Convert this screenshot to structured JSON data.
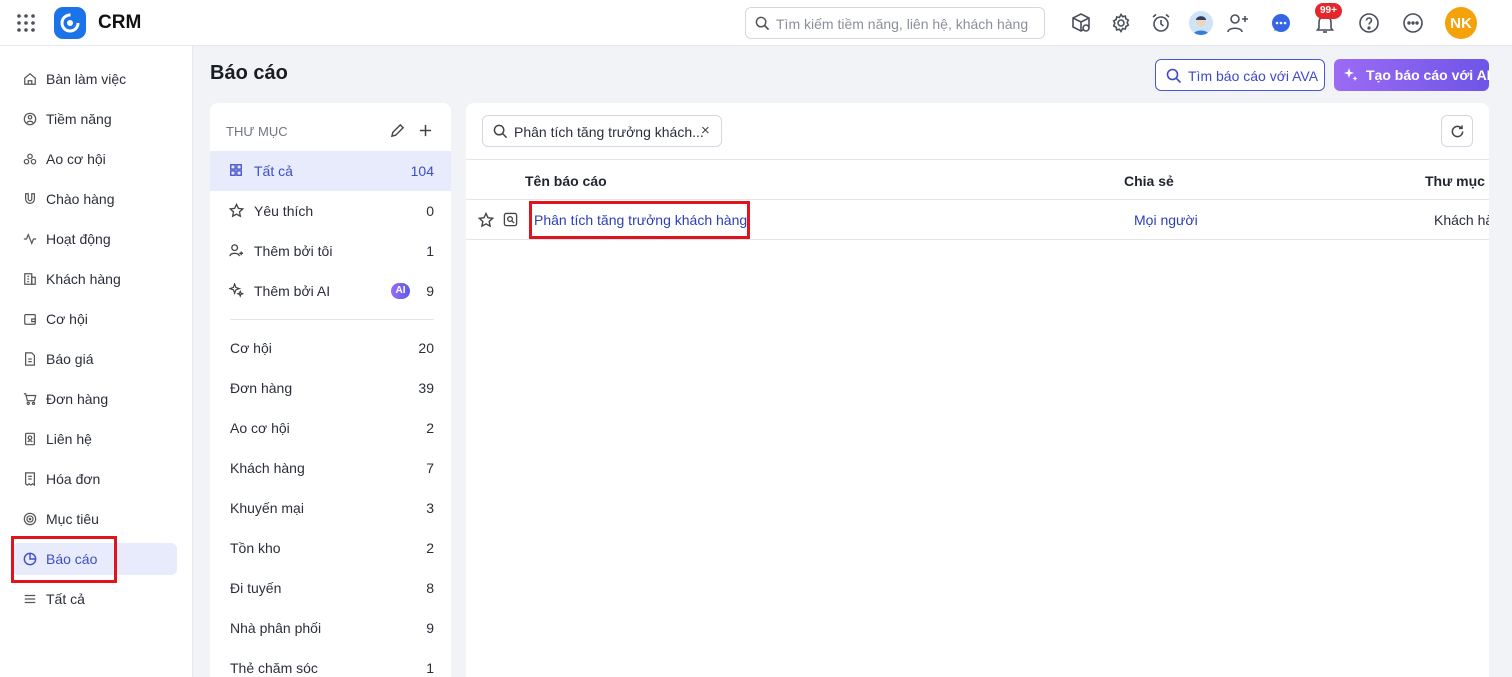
{
  "app": {
    "name": "CRM"
  },
  "search": {
    "placeholder": "Tìm kiếm tiềm năng, liên hệ, khách hàng"
  },
  "notifications": {
    "badge": "99+"
  },
  "user": {
    "initials": "NK"
  },
  "sidebar": {
    "items": [
      {
        "label": "Bàn làm việc",
        "icon": "home-icon"
      },
      {
        "label": "Tiềm năng",
        "icon": "lead-icon"
      },
      {
        "label": "Ao cơ hội",
        "icon": "pool-icon"
      },
      {
        "label": "Chào hàng",
        "icon": "magnet-icon"
      },
      {
        "label": "Hoạt động",
        "icon": "activity-icon"
      },
      {
        "label": "Khách hàng",
        "icon": "building-icon"
      },
      {
        "label": "Cơ hội",
        "icon": "wallet-icon"
      },
      {
        "label": "Báo giá",
        "icon": "quote-icon"
      },
      {
        "label": "Đơn hàng",
        "icon": "cart-icon"
      },
      {
        "label": "Liên hệ",
        "icon": "contact-icon"
      },
      {
        "label": "Hóa đơn",
        "icon": "invoice-icon"
      },
      {
        "label": "Mục tiêu",
        "icon": "target-icon"
      },
      {
        "label": "Báo cáo",
        "icon": "pie-chart-icon",
        "active": true
      },
      {
        "label": "Tất cả",
        "icon": "menu-icon"
      }
    ]
  },
  "page": {
    "title": "Báo cáo",
    "ava_button": "Tìm báo cáo với AVA",
    "ai_button": "Tạo báo cáo với AI"
  },
  "folders": {
    "heading": "THƯ MỤC",
    "special": [
      {
        "label": "Tất cả",
        "count": "104",
        "icon": "grid-icon",
        "active": true
      },
      {
        "label": "Yêu thích",
        "count": "0",
        "icon": "star-icon"
      },
      {
        "label": "Thêm bởi tôi",
        "count": "1",
        "icon": "user-add-icon"
      },
      {
        "label": "Thêm bởi AI",
        "count": "9",
        "icon": "sparkle-icon",
        "chip": "AI"
      }
    ],
    "list": [
      {
        "label": "Cơ hội",
        "count": "20"
      },
      {
        "label": "Đơn hàng",
        "count": "39"
      },
      {
        "label": "Ao cơ hội",
        "count": "2"
      },
      {
        "label": "Khách hàng",
        "count": "7"
      },
      {
        "label": "Khuyến mại",
        "count": "3"
      },
      {
        "label": "Tồn kho",
        "count": "2"
      },
      {
        "label": "Đi tuyến",
        "count": "8"
      },
      {
        "label": "Nhà phân phối",
        "count": "9"
      },
      {
        "label": "Thẻ chăm sóc",
        "count": "1"
      }
    ]
  },
  "filter": {
    "chip_text": "Phân tích tăng trưởng khách...",
    "clear": "×"
  },
  "table": {
    "columns": [
      "Tên báo cáo",
      "Chia sẻ",
      "Thư mục"
    ],
    "rows": [
      {
        "name": "Phân tích tăng trưởng khách hàng",
        "share": "Mọi người",
        "folder": "Khách hà"
      }
    ]
  }
}
